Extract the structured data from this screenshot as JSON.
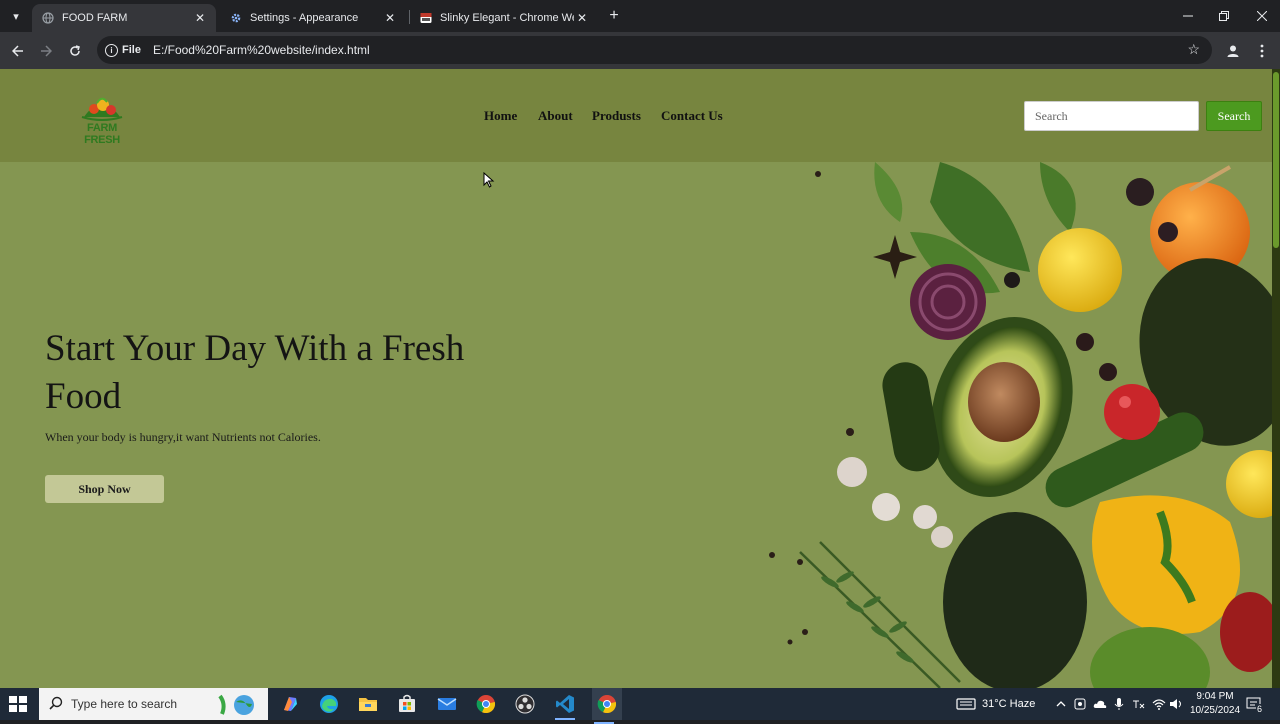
{
  "browser": {
    "tabs": [
      {
        "title": "FOOD FARM",
        "active": true
      },
      {
        "title": "Settings - Appearance",
        "active": false
      },
      {
        "title": "Slinky Elegant - Chrome Web St",
        "active": false
      }
    ],
    "address": {
      "chip": "File",
      "url": "E:/Food%20Farm%20website/index.html"
    }
  },
  "site": {
    "logo_text": "FARM FRESH",
    "nav": [
      "Home",
      "About",
      "Produsts",
      "Contact Us"
    ],
    "search": {
      "placeholder": "Search",
      "button": "Search"
    },
    "hero": {
      "title": "Start Your Day With a Fresh Food",
      "subtitle": "When your body is hungry,it want Nutrients not Calories.",
      "button": "Shop Now"
    }
  },
  "taskbar": {
    "search_placeholder": "Type here to search",
    "weather": "31°C  Haze",
    "time": "9:04 PM",
    "date": "10/25/2024",
    "notification_count": "6"
  },
  "colors": {
    "page_bg": "#849651",
    "header_bg": "#77853f",
    "search_button": "#4c9a1f",
    "shop_button": "#c3c896"
  }
}
